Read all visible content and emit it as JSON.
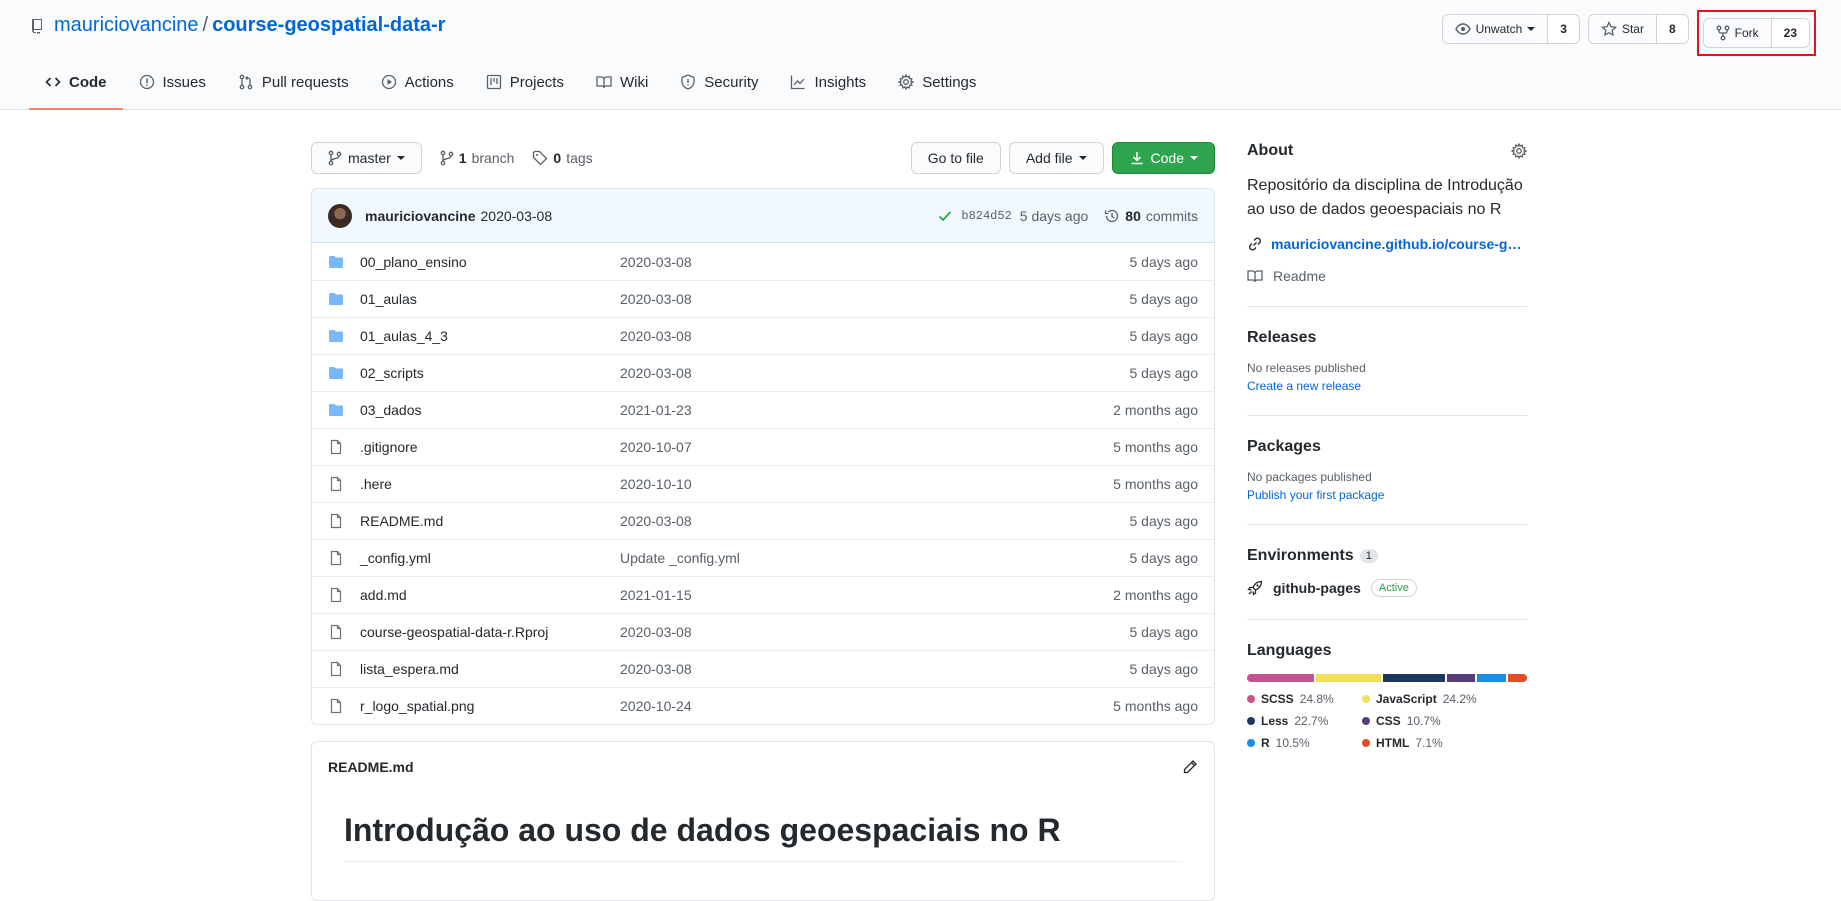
{
  "repo": {
    "owner": "mauriciovancine",
    "separator": "/",
    "name": "course-geospatial-data-r"
  },
  "header_actions": {
    "unwatch": {
      "label": "Unwatch",
      "count": "3"
    },
    "star": {
      "label": "Star",
      "count": "8"
    },
    "fork": {
      "label": "Fork",
      "count": "23"
    }
  },
  "tabs": [
    {
      "label": "Code"
    },
    {
      "label": "Issues"
    },
    {
      "label": "Pull requests"
    },
    {
      "label": "Actions"
    },
    {
      "label": "Projects"
    },
    {
      "label": "Wiki"
    },
    {
      "label": "Security"
    },
    {
      "label": "Insights"
    },
    {
      "label": "Settings"
    }
  ],
  "toolbar": {
    "branch": "master",
    "branch_count": "1",
    "branch_label": "branch",
    "tag_count": "0",
    "tag_label": "tags",
    "go_to_file": "Go to file",
    "add_file": "Add file",
    "code": "Code"
  },
  "commit": {
    "author": "mauriciovancine",
    "message": "2020-03-08",
    "sha": "b824d52",
    "time": "5 days ago",
    "count": "80",
    "count_label": "commits"
  },
  "files": [
    {
      "name": "00_plano_ensino",
      "msg": "2020-03-08",
      "age": "5 days ago",
      "type": "dir"
    },
    {
      "name": "01_aulas",
      "msg": "2020-03-08",
      "age": "5 days ago",
      "type": "dir"
    },
    {
      "name": "01_aulas_4_3",
      "msg": "2020-03-08",
      "age": "5 days ago",
      "type": "dir"
    },
    {
      "name": "02_scripts",
      "msg": "2020-03-08",
      "age": "5 days ago",
      "type": "dir"
    },
    {
      "name": "03_dados",
      "msg": "2021-01-23",
      "age": "2 months ago",
      "type": "dir"
    },
    {
      "name": ".gitignore",
      "msg": "2020-10-07",
      "age": "5 months ago",
      "type": "file"
    },
    {
      "name": ".here",
      "msg": "2020-10-10",
      "age": "5 months ago",
      "type": "file"
    },
    {
      "name": "README.md",
      "msg": "2020-03-08",
      "age": "5 days ago",
      "type": "file"
    },
    {
      "name": "_config.yml",
      "msg": "Update _config.yml",
      "age": "5 days ago",
      "type": "file"
    },
    {
      "name": "add.md",
      "msg": "2021-01-15",
      "age": "2 months ago",
      "type": "file"
    },
    {
      "name": "course-geospatial-data-r.Rproj",
      "msg": "2020-03-08",
      "age": "5 days ago",
      "type": "file"
    },
    {
      "name": "lista_espera.md",
      "msg": "2020-03-08",
      "age": "5 days ago",
      "type": "file"
    },
    {
      "name": "r_logo_spatial.png",
      "msg": "2020-10-24",
      "age": "5 months ago",
      "type": "file"
    }
  ],
  "readme": {
    "filename": "README.md",
    "heading": "Introdução ao uso de dados geoespaciais no R"
  },
  "about": {
    "title": "About",
    "description": "Repositório da disciplina de Introdução ao uso de dados geoespaciais no R",
    "link": "mauriciovancine.github.io/course-g…",
    "readme": "Readme"
  },
  "releases": {
    "title": "Releases",
    "none": "No releases published",
    "create": "Create a new release"
  },
  "packages": {
    "title": "Packages",
    "none": "No packages published",
    "publish": "Publish your first package"
  },
  "environments": {
    "title": "Environments",
    "count": "1",
    "name": "github-pages",
    "status": "Active"
  },
  "languages": {
    "title": "Languages",
    "items": [
      {
        "name": "SCSS",
        "pct": "24.8%",
        "value": 24.8,
        "color": "#c6538c"
      },
      {
        "name": "JavaScript",
        "pct": "24.2%",
        "value": 24.2,
        "color": "#f1e05a"
      },
      {
        "name": "Less",
        "pct": "22.7%",
        "value": 22.7,
        "color": "#1d365d"
      },
      {
        "name": "CSS",
        "pct": "10.7%",
        "value": 10.7,
        "color": "#563d7c"
      },
      {
        "name": "R",
        "pct": "10.5%",
        "value": 10.5,
        "color": "#198ce7"
      },
      {
        "name": "HTML",
        "pct": "7.1%",
        "value": 7.1,
        "color": "#e34c26"
      }
    ]
  }
}
